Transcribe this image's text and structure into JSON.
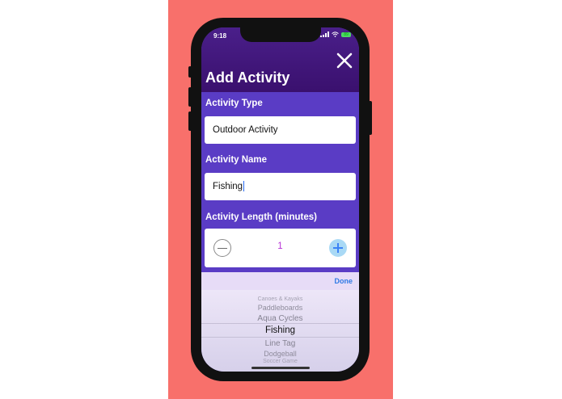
{
  "status": {
    "time": "9:18",
    "battery_label": "89"
  },
  "header": {
    "title": "Add Activity"
  },
  "form": {
    "type_label": "Activity Type",
    "type_value": "Outdoor Activity",
    "name_label": "Activity Name",
    "name_value": "Fishing",
    "length_label": "Activity Length (minutes)",
    "length_value": "1"
  },
  "toolbar": {
    "done_label": "Done"
  },
  "picker": {
    "options": [
      "Canoes & Kayaks",
      "Paddleboards",
      "Aqua Cycles",
      "Fishing",
      "Line Tag",
      "Dodgeball",
      "Soccer Game"
    ],
    "selected_index": 3
  },
  "colors": {
    "backdrop": "#f8706b",
    "header": "#3a106e",
    "form_bg": "#5a3cc5",
    "stepper_value": "#b730d6",
    "done": "#2f7ae5"
  }
}
